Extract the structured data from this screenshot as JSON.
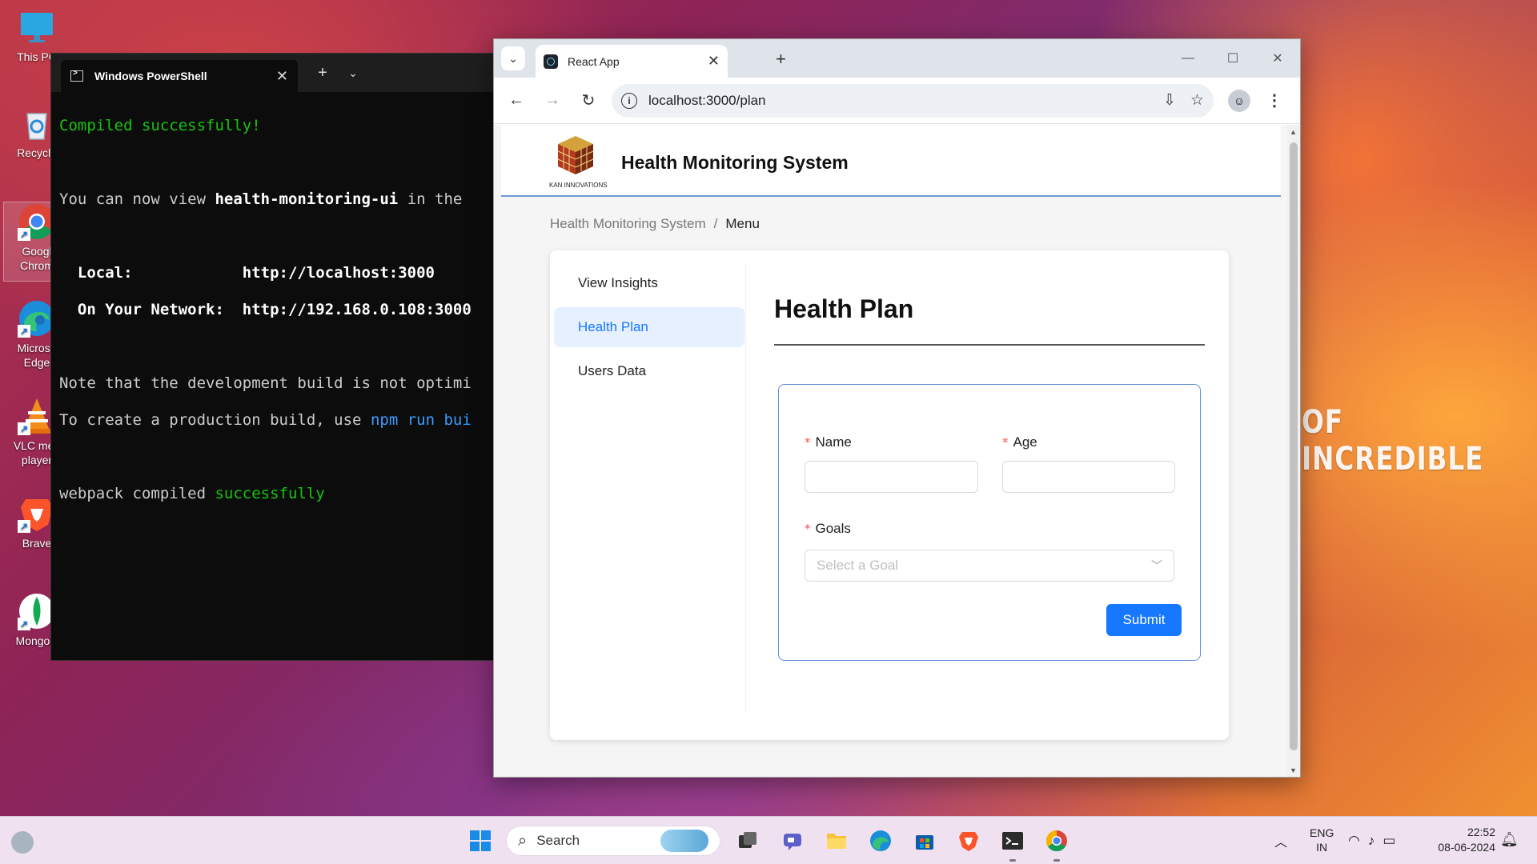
{
  "desktop": {
    "wallpaper_text": "OF INCREDIBLE",
    "icons": [
      {
        "label": "This PC",
        "icon": "monitor-icon"
      },
      {
        "label": "Recycle",
        "icon": "recycle-bin-icon"
      },
      {
        "label": "Googl Chrom",
        "icon": "chrome-icon"
      },
      {
        "label": "Microso Edge",
        "icon": "edge-icon"
      },
      {
        "label": "VLC med player",
        "icon": "vlc-icon"
      },
      {
        "label": "Brave",
        "icon": "brave-icon"
      },
      {
        "label": "MongoD",
        "icon": "mongodb-icon"
      }
    ]
  },
  "powershell": {
    "tab_title": "Windows PowerShell",
    "lines": {
      "compiled": "Compiled successfully!",
      "view_prefix": "You can now view ",
      "view_app": "health-monitoring-ui",
      "view_suffix": " in the",
      "local_label": "  Local:            ",
      "local_url": "http://localhost:3000",
      "network_label": "  On Your Network:  ",
      "network_url": "http://192.168.0.108:3000",
      "note": "Note that the development build is not optimi",
      "create_prefix": "To create a production build, use ",
      "create_cmd": "npm run bui",
      "webpack_prefix": "webpack compiled ",
      "webpack_status": "successfully"
    }
  },
  "browser": {
    "tab_title": "React App",
    "url": "localhost:3000/plan",
    "colors": {
      "accent": "#1677ff",
      "header_border": "#6f9ad6",
      "active_menu_bg": "#e6f0ff"
    }
  },
  "app": {
    "title": "Health Monitoring System",
    "logo_text": "KAN INNOVATIONS",
    "breadcrumb": [
      "Health Monitoring System",
      "Menu"
    ],
    "breadcrumb_sep": "/",
    "menu": [
      {
        "label": "View Insights",
        "active": false
      },
      {
        "label": "Health Plan",
        "active": true
      },
      {
        "label": "Users Data",
        "active": false
      }
    ],
    "page_title": "Health Plan",
    "form": {
      "required_mark": "*",
      "name_label": "Name",
      "name_value": "",
      "age_label": "Age",
      "age_value": "",
      "goals_label": "Goals",
      "goals_placeholder": "Select a Goal",
      "submit_label": "Submit"
    }
  },
  "taskbar": {
    "search_placeholder": "Search",
    "lang_line1": "ENG",
    "lang_line2": "IN",
    "time": "22:52",
    "date": "08-06-2024"
  }
}
